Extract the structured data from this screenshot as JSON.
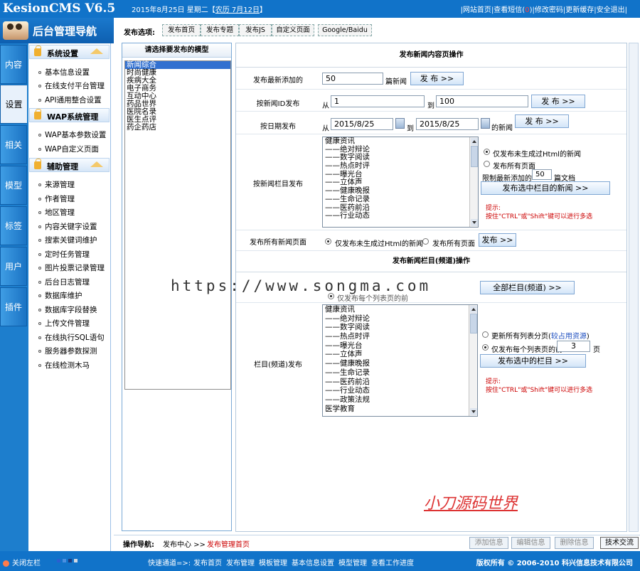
{
  "app": {
    "name": "KesionCMS V6.5",
    "date_text": "2015年8月25日 星期二【",
    "lunar_text": "农历 7月12日",
    "date_close": "】",
    "toplinks": [
      "|网站首页",
      "|查看短信(",
      "0",
      ")|修改密码",
      "|更新缓存",
      "|安全退出|"
    ]
  },
  "nav": {
    "title": "后台管理导航",
    "vtabs": [
      "内容",
      "设置",
      "相关",
      "模型",
      "标签",
      "用户",
      "插件"
    ],
    "sections": [
      {
        "title": "系统设置",
        "items": [
          "基本信息设置",
          "在线支付平台管理",
          "API通用整合设置"
        ]
      },
      {
        "title": "WAP系统管理",
        "items": [
          "WAP基本参数设置",
          "WAP自定义页面"
        ]
      },
      {
        "title": "辅助管理",
        "items": [
          "来源管理",
          "作者管理",
          "地区管理",
          "内容关键字设置",
          "搜索关键词维护",
          "定时任务管理",
          "图片投票记录管理",
          "后台日志管理",
          "数据库维护",
          "数据库字段替换",
          "上传文件管理",
          "在线执行SQL语句",
          "服务器参数探测",
          "在线检测木马"
        ]
      }
    ]
  },
  "publish_toolbar": {
    "label": "发布选项:",
    "buttons": [
      "发布首页",
      "发布专题",
      "发布JS",
      "自定义页面",
      "Google/Baidu"
    ]
  },
  "model_panel": {
    "header": "请选择要发布的模型",
    "options": [
      "新闻综合",
      "时尚健康",
      "疾病大全",
      "电子商务",
      "互动中心",
      "药品世界",
      "医院名录",
      "医生点评",
      "药企药店"
    ],
    "selected_index": 0
  },
  "content_publish": {
    "header": "发布新闻内容页操作",
    "latest_label": "发布最新添加的",
    "latest_value": "50",
    "latest_suffix": "篇新闻",
    "publish_btn": "发 布 >>",
    "byid_label": "按新闻ID发布",
    "from": "从",
    "to": "到",
    "id_from": "1",
    "id_to": "100",
    "bydate_label": "按日期发布",
    "date_from": "2015/8/25",
    "date_to": "2015/8/25",
    "date_suffix": "的新闻",
    "bycolumn_label": "按新闻栏目发布",
    "columns": [
      "健康资讯",
      "——绝对辩论",
      "——数字阅读",
      "——热点时评",
      "——曝光台",
      "——立体声",
      "——健康晚报",
      "——生命记录",
      "——医药前沿",
      "——行业动态"
    ],
    "radio1": "仅发布未生成过Html的新闻",
    "radio2": "发布所有页面",
    "limit_label": "限制最新添加的",
    "limit_value": "50",
    "limit_suffix": "篇文档",
    "publish_column_btn": "发布选中栏目的新闻 >>",
    "hint_title": "提示:",
    "hint_text": "按住\"CTRL\"或\"Shift\"键可以进行多选",
    "all_label": "发布所有新闻页面",
    "all_radio1": "仅发布未生成过Html的新闻",
    "all_radio2": "发布所有页面",
    "all_btn": "发布 >>"
  },
  "channel_publish": {
    "header": "发布新闻栏目(频道)操作",
    "all_btn": "全部栏目(频道) >>",
    "partial_radio": "仅发布每个列表页的前",
    "column_label": "栏目(频道)发布",
    "columns": [
      "健康资讯",
      "——绝对辩论",
      "——数字阅读",
      "——热点时评",
      "——曝光台",
      "——立体声",
      "——健康晚报",
      "——生命记录",
      "——医药前沿",
      "——行业动态",
      "——政策法规",
      "医学教育"
    ],
    "radio1_a": "更新所有列表分页(",
    "radio1_b": "较占用资源",
    "radio1_c": ")",
    "radio2": "仅发布每个列表页的前",
    "pages_value": "3",
    "pages_suffix": "页",
    "btn": "发布选中的栏目 >>",
    "hint_title": "提示:",
    "hint_text": "按住\"CTRL\"或\"Shift\"键可以进行多选"
  },
  "watermark": {
    "url": "https://www.songma.com",
    "brand": "小刀源码世界"
  },
  "op_nav": {
    "label": "操作导航:",
    "center": "发布中心 >>",
    "current": "发布管理首页",
    "buttons": [
      "添加信息",
      "编辑信息",
      "删除信息",
      "技术交流"
    ]
  },
  "footer": {
    "close": "关闭左栏",
    "quick": "快速通道=>:",
    "links": [
      "发布首页",
      "发布管理",
      "模板管理",
      "基本信息设置",
      "模型管理",
      "查看工作进度"
    ],
    "copyright": "版权所有 © 2006-2010 科兴信息技术有限公司"
  },
  "colors": {
    "topbar": "#1173c9",
    "selected": "#3170d0",
    "hint": "#cc0000"
  }
}
